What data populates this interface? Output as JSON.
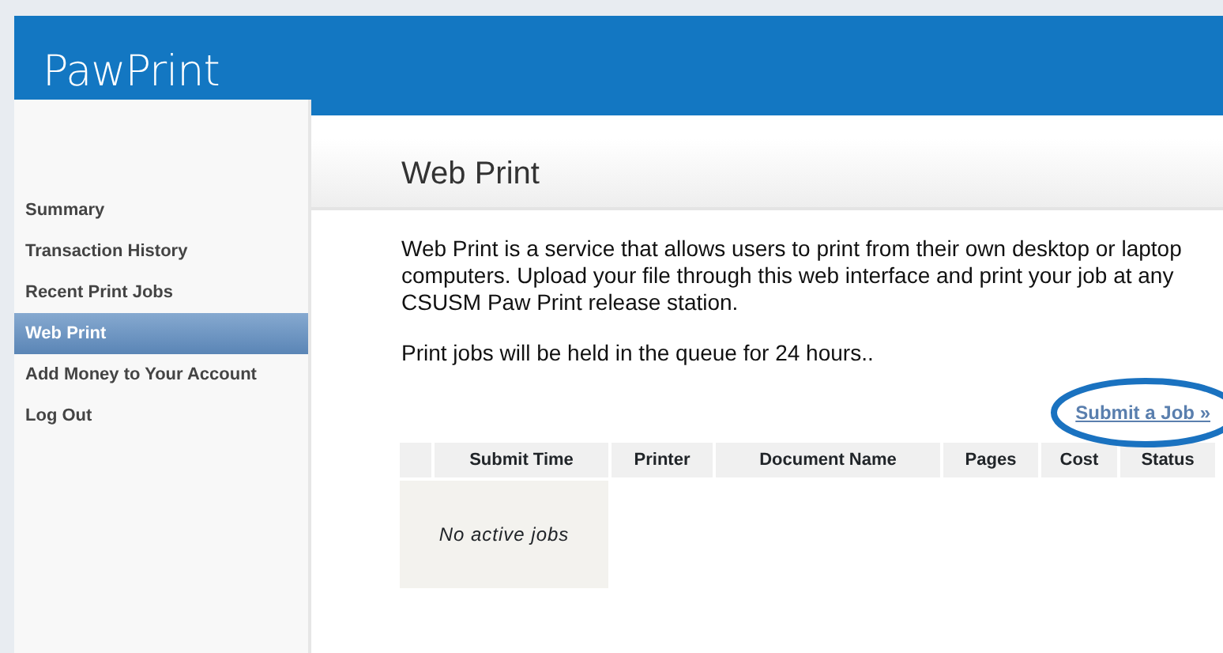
{
  "header": {
    "logo": "PawPrint"
  },
  "sidebar": {
    "items": [
      {
        "label": "Summary",
        "selected": false
      },
      {
        "label": "Transaction History",
        "selected": false
      },
      {
        "label": "Recent Print Jobs",
        "selected": false
      },
      {
        "label": "Web Print",
        "selected": true
      },
      {
        "label": "Add Money to Your Account",
        "selected": false
      },
      {
        "label": "Log Out",
        "selected": false
      }
    ]
  },
  "page": {
    "title": "Web Print",
    "paragraphs": [
      "Web Print is a service that allows users to print from their own desktop or laptop computers. Upload your file through this web interface and print your job at any CSUSM Paw Print release station.",
      "Print jobs will be held in the queue for 24 hours.."
    ],
    "submit_link": "Submit a Job »",
    "table": {
      "columns": [
        "Submit Time",
        "Printer",
        "Document Name",
        "Pages",
        "Cost",
        "Status"
      ],
      "empty_message": "No active jobs"
    }
  }
}
